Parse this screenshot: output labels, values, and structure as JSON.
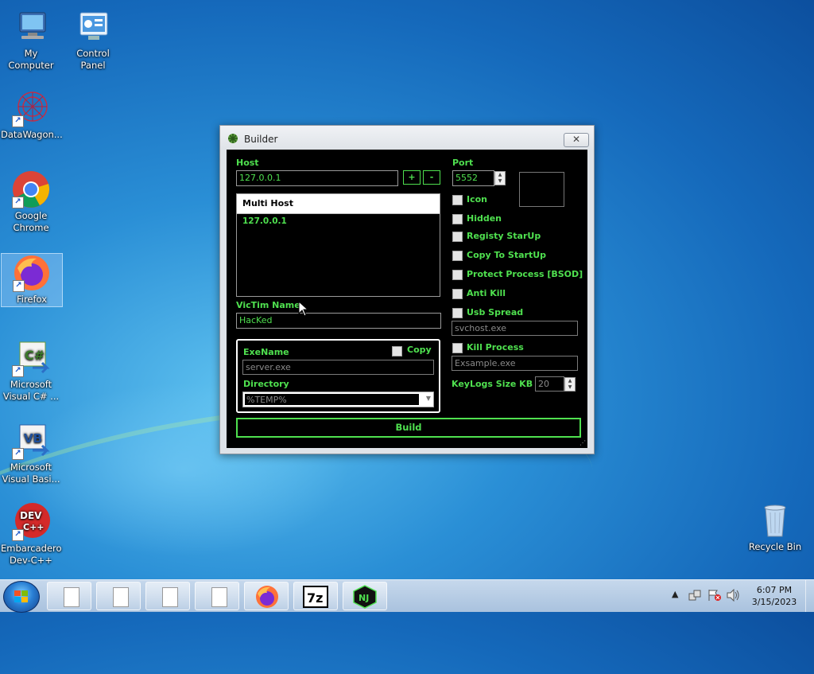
{
  "desktop": {
    "icons": [
      {
        "label": "My Computer"
      },
      {
        "label": "Control Panel"
      },
      {
        "label": "DataWagon..."
      },
      {
        "label": "Google Chrome"
      },
      {
        "label": "Firefox"
      },
      {
        "label": "Microsoft Visual C# ..."
      },
      {
        "label": "Microsoft Visual Basi..."
      },
      {
        "label": "Embarcadero Dev-C++"
      },
      {
        "label": "Recycle Bin"
      }
    ]
  },
  "builder": {
    "title": "Builder",
    "close_glyph": "✕",
    "host_label": "Host",
    "host_value": "127.0.0.1",
    "add_label": "+",
    "remove_label": "-",
    "list_header": "Multi Host",
    "list_items": [
      "127.0.0.1"
    ],
    "victim_label": "VicTim Name",
    "victim_value": "HacKed",
    "exename_label": "ExeName",
    "exename_placeholder": "server.exe",
    "copy_label": "Copy",
    "directory_label": "Directory",
    "directory_value": "%TEMP%",
    "port_label": "Port",
    "port_value": "5552",
    "options": [
      {
        "label": "Icon",
        "checked": false
      },
      {
        "label": "Hidden",
        "checked": false
      },
      {
        "label": "Registy StarUp",
        "checked": false
      },
      {
        "label": "Copy To StartUp",
        "checked": false
      },
      {
        "label": "Protect Process [BSOD]",
        "checked": false
      },
      {
        "label": "Anti Kill",
        "checked": false
      },
      {
        "label": "Usb Spread",
        "checked": false
      }
    ],
    "usb_value": "svchost.exe",
    "kill_label": "Kill Process",
    "kill_value": "Exsample.exe",
    "keylogs_label": "KeyLogs Size KB",
    "keylogs_value": "20",
    "build_label": "Build",
    "accent_color": "#4fe04f"
  },
  "taskbar": {
    "pinned": [
      "document",
      "document",
      "document",
      "document",
      "firefox",
      "7-zip",
      "njrat"
    ],
    "clock_time": "6:07 PM",
    "clock_date": "3/15/2023"
  }
}
